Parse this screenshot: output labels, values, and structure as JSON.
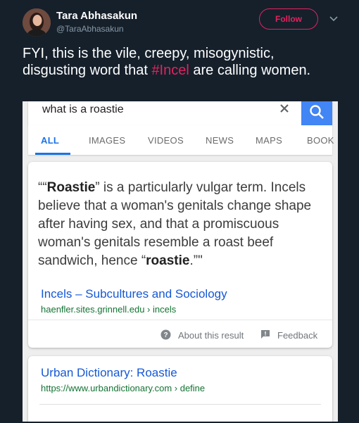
{
  "tweet": {
    "author_name": "Tara Abhasakun",
    "author_handle": "@TaraAbhasakun",
    "follow_label": "Follow",
    "text_before": "FYI, this is the vile, creepy, misogynistic, disgusting word that ",
    "hashtag": "#Incel",
    "text_after": " are calling women.",
    "colors": {
      "background": "#15202b",
      "accent": "#e0245e"
    }
  },
  "screenshot": {
    "search": {
      "query": "what is a roastie"
    },
    "tabs": [
      "ALL",
      "IMAGES",
      "VIDEOS",
      "NEWS",
      "MAPS",
      "BOOK"
    ],
    "active_tab": "ALL",
    "featured": {
      "open_quote": "““",
      "term": "Roastie",
      "text_1": "” is a particularly vulgar term. Incels believe that a woman's genitals change shape after having sex, and that a promiscuous woman's genitals resemble a roast beef sandwich, hence “",
      "term_2": "roastie",
      "text_2": ".”\"",
      "source_title": "Incels – Subcultures and Sociology",
      "source_url": "haenfler.sites.grinnell.edu › incels",
      "about_label": "About this result",
      "feedback_label": "Feedback"
    },
    "result2": {
      "title": "Urban Dictionary: Roastie",
      "url": "https://www.urbandictionary.com › define"
    }
  }
}
